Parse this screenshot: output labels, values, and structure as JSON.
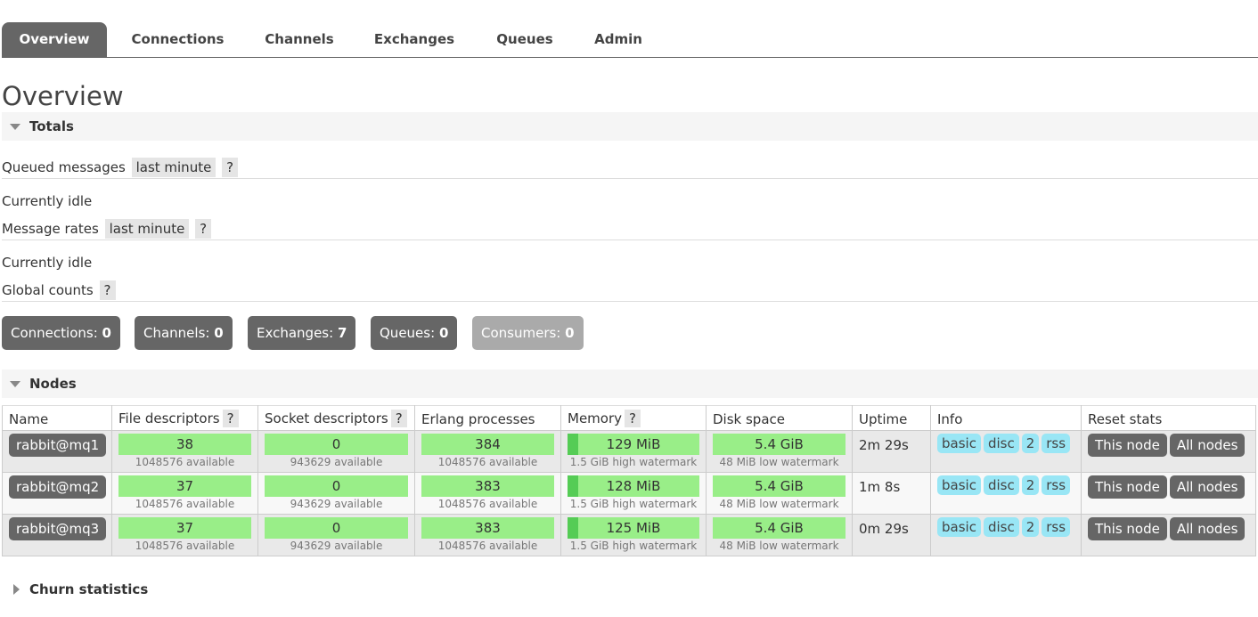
{
  "tabs": [
    "Overview",
    "Connections",
    "Channels",
    "Exchanges",
    "Queues",
    "Admin"
  ],
  "page_title": "Overview",
  "totals": {
    "header": "Totals",
    "queued_label": "Queued messages",
    "queued_range": "last minute",
    "queued_help": "?",
    "queued_status": "Currently idle",
    "rates_label": "Message rates",
    "rates_range": "last minute",
    "rates_help": "?",
    "rates_status": "Currently idle",
    "global_label": "Global counts",
    "global_help": "?"
  },
  "counts": [
    {
      "label": "Connections:",
      "value": "0"
    },
    {
      "label": "Channels:",
      "value": "0"
    },
    {
      "label": "Exchanges:",
      "value": "7"
    },
    {
      "label": "Queues:",
      "value": "0"
    },
    {
      "label": "Consumers:",
      "value": "0"
    }
  ],
  "nodes": {
    "header": "Nodes",
    "columns": {
      "name": "Name",
      "fd": "File descriptors",
      "sd": "Socket descriptors",
      "erlang": "Erlang processes",
      "memory": "Memory",
      "disk": "Disk space",
      "uptime": "Uptime",
      "info": "Info",
      "reset": "Reset stats",
      "help": "?"
    },
    "rows": [
      {
        "name": "rabbit@mq1",
        "fd": "38",
        "fd_avail": "1048576 available",
        "sd": "0",
        "sd_avail": "943629 available",
        "erlang": "384",
        "erlang_avail": "1048576 available",
        "memory": "129 MiB",
        "memory_sub": "1.5 GiB high watermark",
        "disk": "5.4 GiB",
        "disk_sub": "48 MiB low watermark",
        "uptime": "2m 29s",
        "info": [
          "basic",
          "disc",
          "2",
          "rss"
        ],
        "reset_this": "This node",
        "reset_all": "All nodes"
      },
      {
        "name": "rabbit@mq2",
        "fd": "37",
        "fd_avail": "1048576 available",
        "sd": "0",
        "sd_avail": "943629 available",
        "erlang": "383",
        "erlang_avail": "1048576 available",
        "memory": "128 MiB",
        "memory_sub": "1.5 GiB high watermark",
        "disk": "5.4 GiB",
        "disk_sub": "48 MiB low watermark",
        "uptime": "1m 8s",
        "info": [
          "basic",
          "disc",
          "2",
          "rss"
        ],
        "reset_this": "This node",
        "reset_all": "All nodes"
      },
      {
        "name": "rabbit@mq3",
        "fd": "37",
        "fd_avail": "1048576 available",
        "sd": "0",
        "sd_avail": "943629 available",
        "erlang": "383",
        "erlang_avail": "1048576 available",
        "memory": "125 MiB",
        "memory_sub": "1.5 GiB high watermark",
        "disk": "5.4 GiB",
        "disk_sub": "48 MiB low watermark",
        "uptime": "0m 29s",
        "info": [
          "basic",
          "disc",
          "2",
          "rss"
        ],
        "reset_this": "This node",
        "reset_all": "All nodes"
      }
    ]
  },
  "churn": {
    "header": "Churn statistics"
  },
  "colors": {
    "tab_active": "#666666",
    "bar_green": "#99ee88",
    "bar_fill": "#55cc55",
    "info_tag": "#99e6f5",
    "count_disabled": "#aaaaaa"
  }
}
